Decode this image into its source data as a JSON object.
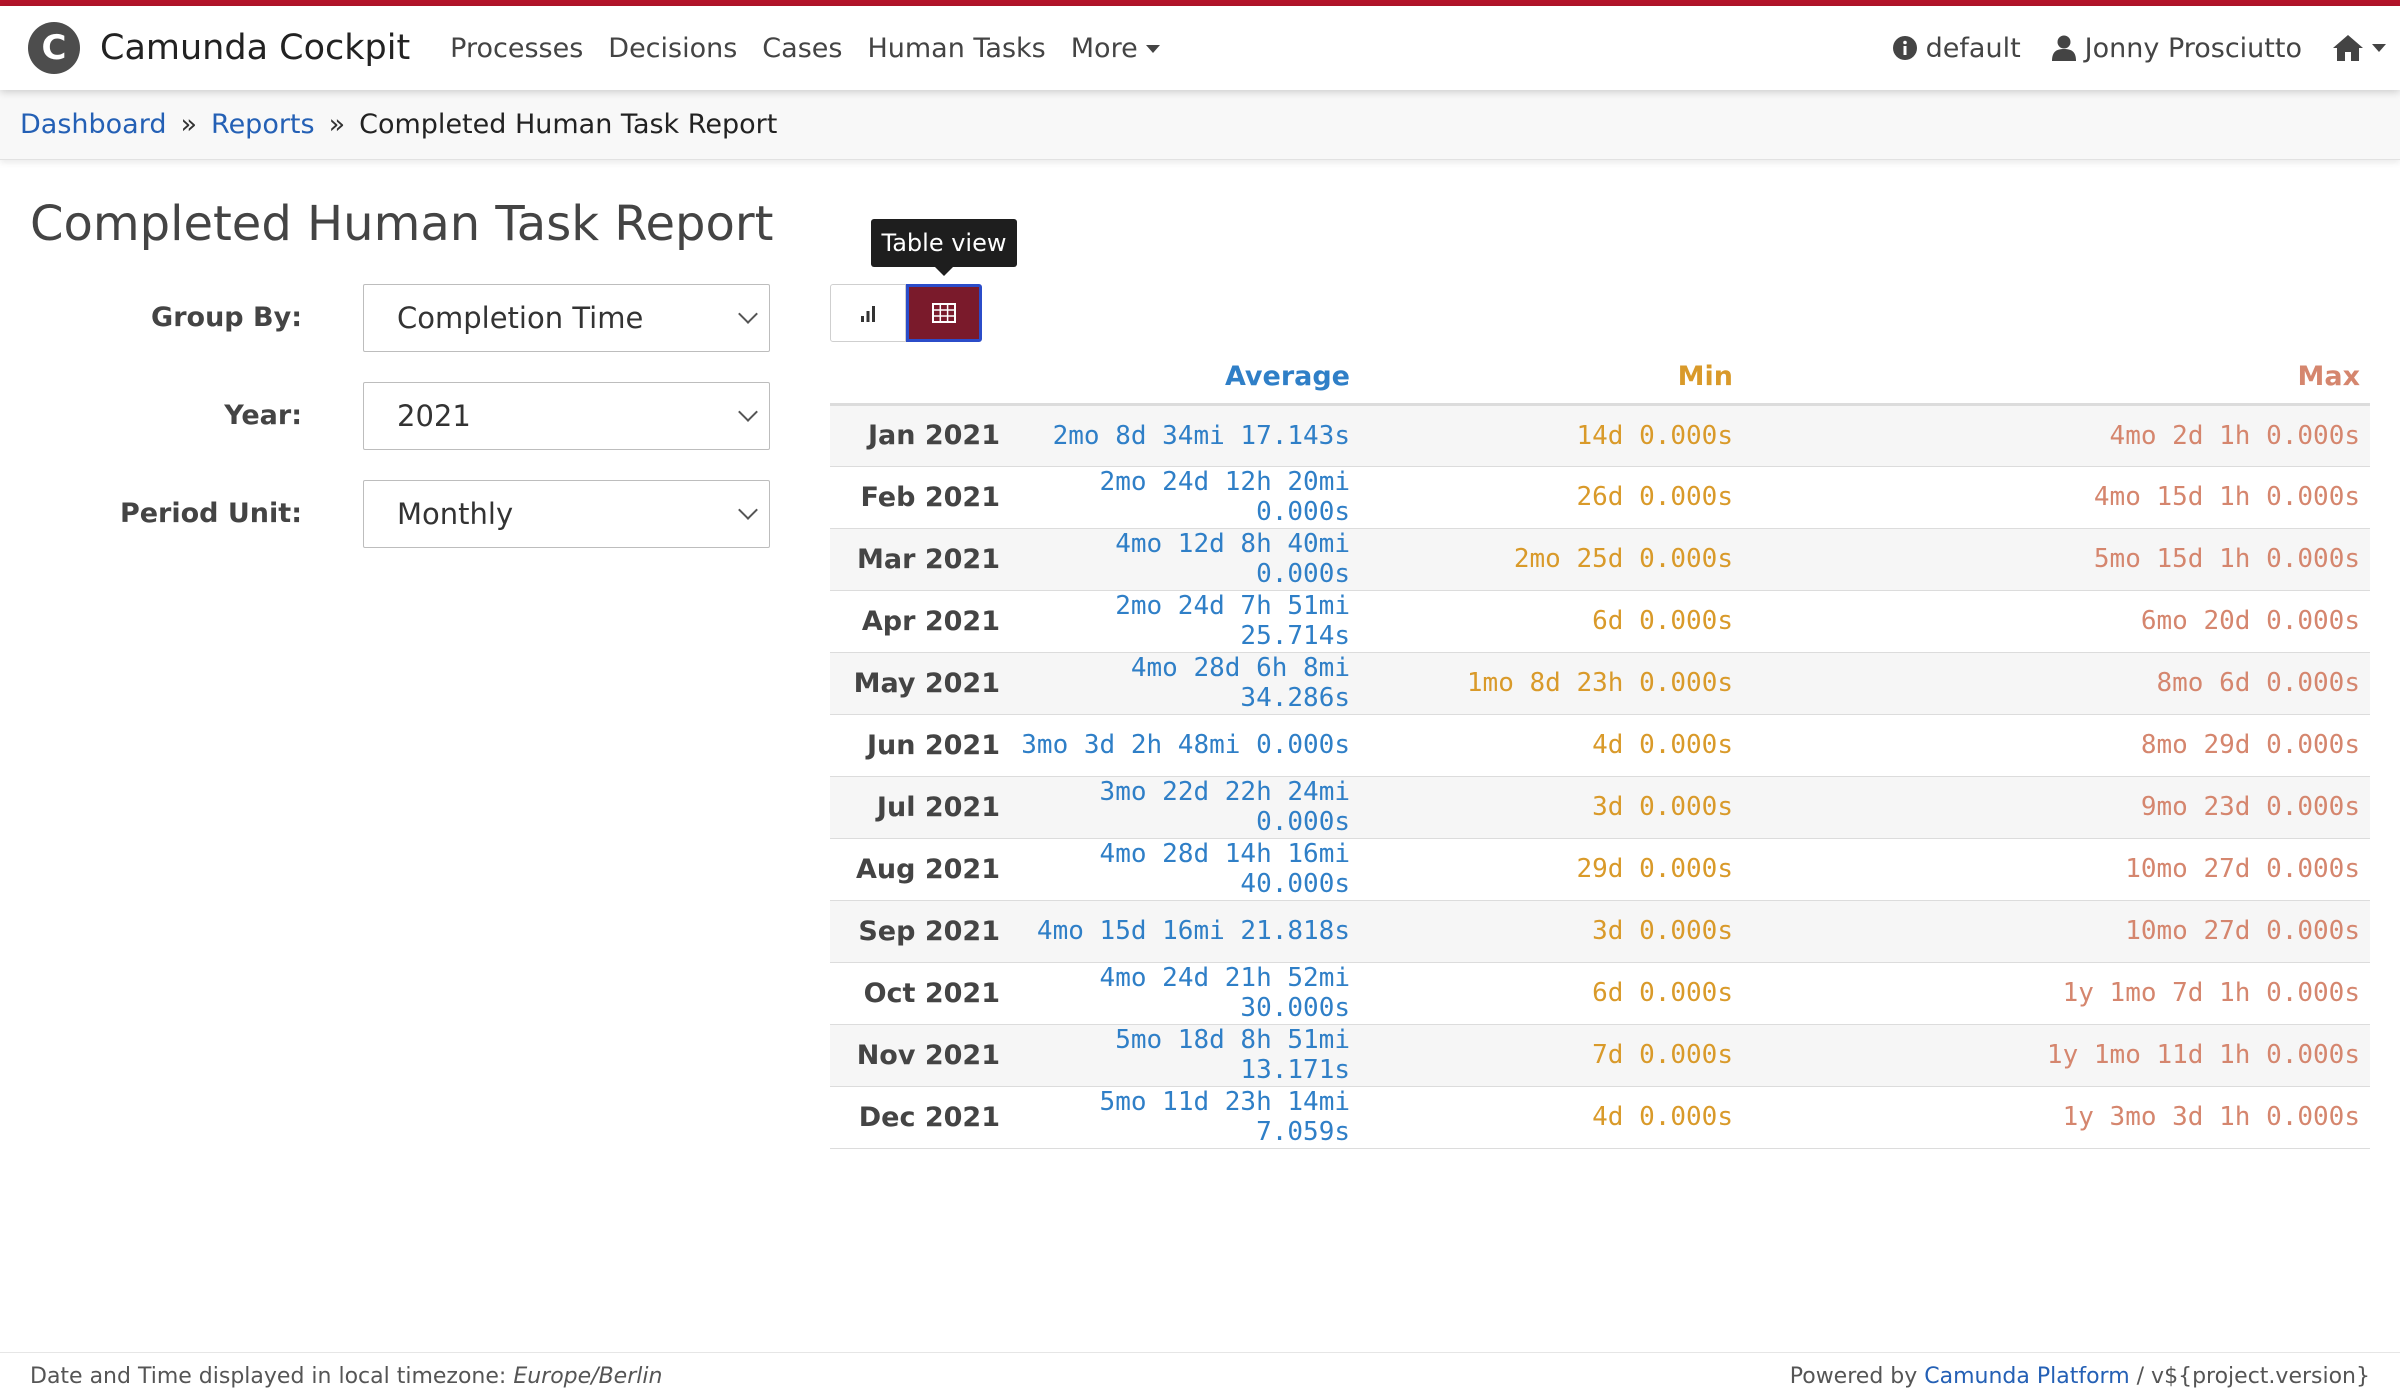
{
  "brand": {
    "name": "Camunda Cockpit",
    "logo_glyph": "C"
  },
  "nav": {
    "links": [
      "Processes",
      "Decisions",
      "Cases",
      "Human Tasks"
    ],
    "more_label": "More",
    "engine_label": "default",
    "user_label": "Jonny Prosciutto"
  },
  "breadcrumb": {
    "dashboard": "Dashboard",
    "reports": "Reports",
    "separator": "»",
    "current": "Completed Human Task Report"
  },
  "page": {
    "title": "Completed Human Task Report"
  },
  "filters": {
    "group_by": {
      "label": "Group By:",
      "value": "Completion Time"
    },
    "year": {
      "label": "Year:",
      "value": "2021"
    },
    "period_unit": {
      "label": "Period Unit:",
      "value": "Monthly"
    }
  },
  "view_toggle": {
    "tooltip": "Table view",
    "active": "table"
  },
  "table": {
    "headers": {
      "period": "",
      "average": "Average",
      "min": "Min",
      "max": "Max"
    },
    "rows": [
      {
        "period": "Jan 2021",
        "average": "2mo 8d 34mi 17.143s",
        "min": "14d 0.000s",
        "max": "4mo 2d 1h 0.000s"
      },
      {
        "period": "Feb 2021",
        "average": "2mo 24d 12h 20mi 0.000s",
        "min": "26d 0.000s",
        "max": "4mo 15d 1h 0.000s"
      },
      {
        "period": "Mar 2021",
        "average": "4mo 12d 8h 40mi 0.000s",
        "min": "2mo 25d 0.000s",
        "max": "5mo 15d 1h 0.000s"
      },
      {
        "period": "Apr 2021",
        "average": "2mo 24d 7h 51mi 25.714s",
        "min": "6d 0.000s",
        "max": "6mo 20d 0.000s"
      },
      {
        "period": "May 2021",
        "average": "4mo 28d 6h 8mi 34.286s",
        "min": "1mo 8d 23h 0.000s",
        "max": "8mo 6d 0.000s"
      },
      {
        "period": "Jun 2021",
        "average": "3mo 3d 2h 48mi 0.000s",
        "min": "4d 0.000s",
        "max": "8mo 29d 0.000s"
      },
      {
        "period": "Jul 2021",
        "average": "3mo 22d 22h 24mi 0.000s",
        "min": "3d 0.000s",
        "max": "9mo 23d 0.000s"
      },
      {
        "period": "Aug 2021",
        "average": "4mo 28d 14h 16mi 40.000s",
        "min": "29d 0.000s",
        "max": "10mo 27d 0.000s"
      },
      {
        "period": "Sep 2021",
        "average": "4mo 15d 16mi 21.818s",
        "min": "3d 0.000s",
        "max": "10mo 27d 0.000s"
      },
      {
        "period": "Oct 2021",
        "average": "4mo 24d 21h 52mi 30.000s",
        "min": "6d 0.000s",
        "max": "1y 1mo 7d 1h 0.000s"
      },
      {
        "period": "Nov 2021",
        "average": "5mo 18d 8h 51mi 13.171s",
        "min": "7d 0.000s",
        "max": "1y 1mo 11d 1h 0.000s"
      },
      {
        "period": "Dec 2021",
        "average": "5mo 11d 23h 14mi 7.059s",
        "min": "4d 0.000s",
        "max": "1y 3mo 3d 1h 0.000s"
      }
    ]
  },
  "footer": {
    "tz_prefix": "Date and Time displayed in local timezone:",
    "tz_value": "Europe/Berlin",
    "powered_prefix": "Powered by",
    "powered_link": "Camunda Platform",
    "powered_suffix": "/ v${project.version}"
  },
  "colors": {
    "accent": "#b5152b",
    "average": "#2f7fc7",
    "min": "#d99a2a",
    "max": "#d5866e",
    "active_button": "#7a1a2b"
  }
}
